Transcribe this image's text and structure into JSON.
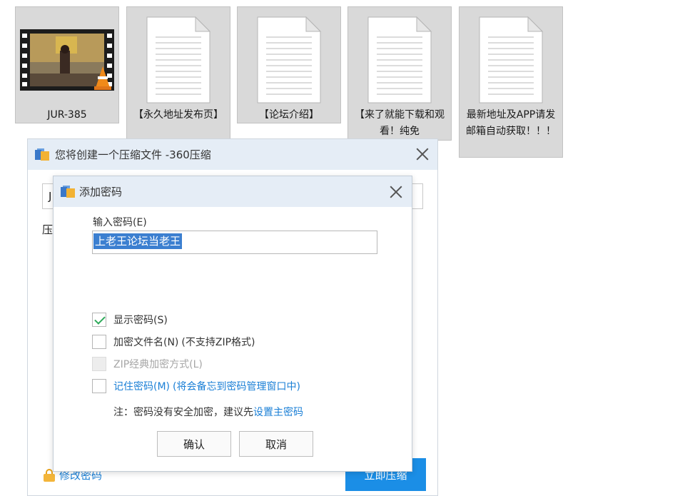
{
  "desktop": {
    "files": [
      {
        "name": "JUR-385",
        "type": "video"
      },
      {
        "name": "【永久地址发布页】",
        "type": "document"
      },
      {
        "name": "【论坛介绍】",
        "type": "document"
      },
      {
        "name": "【来了就能下载和观看！纯免",
        "type": "document"
      },
      {
        "name": "最新地址及APP请发邮箱自动获取！！！",
        "type": "document"
      }
    ]
  },
  "compress_window": {
    "title": "您将创建一个压缩文件 -360压缩",
    "path_value": "J",
    "compress_label": "压",
    "change_password_link": "修改密码",
    "compress_button": "立即压缩"
  },
  "password_dialog": {
    "title": "添加密码",
    "password_label": "输入密码(E)",
    "password_value": "上老王论坛当老王",
    "options": {
      "show_password": {
        "label": "显示密码(S)",
        "checked": true
      },
      "encrypt_filenames": {
        "label": "加密文件名(N)",
        "hint": "(不支持ZIP格式)",
        "checked": false
      },
      "zip_classic": {
        "label": "ZIP经典加密方式(L)",
        "disabled": true
      },
      "remember_password": {
        "label": "记住密码(M)",
        "hint": "(将会备忘到密码管理窗口中)",
        "checked": false
      }
    },
    "note_text": "注：密码没有安全加密，建议先",
    "note_link": "设置主密码",
    "ok_button": "确认",
    "cancel_button": "取消"
  },
  "colors": {
    "titlebar": "#e5edf6",
    "accent_blue": "#1b8ee6",
    "link_blue": "#1a7fd6",
    "selection": "#3b7fd0",
    "check_green": "#2eaa5a"
  }
}
